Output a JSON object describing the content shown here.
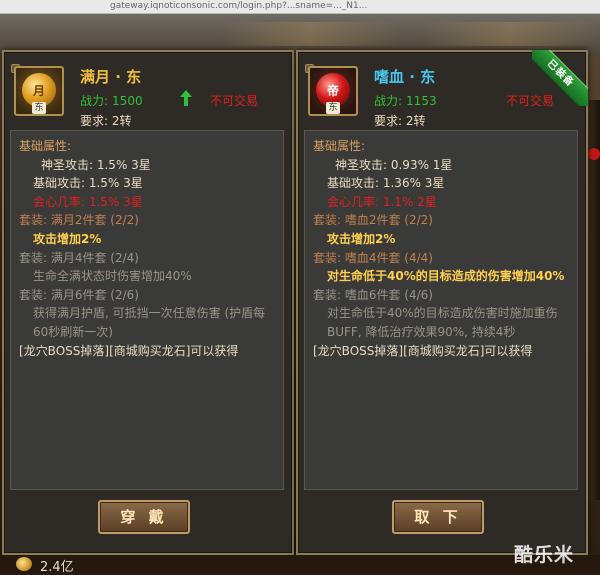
{
  "browser": {
    "url": "gateway.iqnoticonsonic.com/login.php?...sname=..._N1..."
  },
  "left_item": {
    "name": "满月 · 东",
    "orb_char": "月",
    "icon_sub_char": "东",
    "power_label": "战力:",
    "power_value": "1500",
    "trade_status": "不可交易",
    "requirement": "要求: 2转",
    "lines": [
      "基础属性:",
      "神圣攻击: 1.5%  3星",
      "基础攻击: 1.5%  3星",
      "会心几率: 1.5%  3星",
      "套装: 满月2件套 (2/2)",
      "攻击增加2%",
      "套装: 满月4件套 (2/4)",
      "生命全满状态时伤害增加40%",
      "套装: 满月6件套 (2/6)",
      "获得满月护盾, 可抵挡一次任意伤害 (护盾每60秒刷新一次)",
      "[龙穴BOSS掉落][商城购买龙石]可以获得"
    ],
    "button_label": "穿 戴"
  },
  "right_item": {
    "name": "嗜血 · 东",
    "orb_char": "帝",
    "icon_sub_char": "东",
    "power_label": "战力:",
    "power_value": "1153",
    "trade_status": "不可交易",
    "requirement": "要求: 2转",
    "equipped_badge": "已装备",
    "lines": [
      "基础属性:",
      "神圣攻击: 0.93%  1星",
      "基础攻击: 1.36%  3星",
      "会心几率: 1.1%  2星",
      "套装: 嗜血2件套 (2/2)",
      "攻击增加2%",
      "套装: 嗜血4件套 (4/4)",
      "对生命低于40%的目标造成的伤害增加40%",
      "套装: 嗜血6件套 (4/6)",
      "对生命低于40%的目标造成伤害时施加重伤BUFF, 降低治疗效果90%, 持续4秒",
      "[龙穴BOSS掉落][商城购买龙石]可以获得"
    ],
    "button_label": "取 下"
  },
  "footer": {
    "currency": "2.4亿"
  },
  "watermark": "酷乐米",
  "colors": {
    "gold_name": "#f0c040",
    "blue_name": "#48c8f0",
    "power_green": "#34c038",
    "red": "#e02020",
    "active_set": "#ffd050"
  }
}
